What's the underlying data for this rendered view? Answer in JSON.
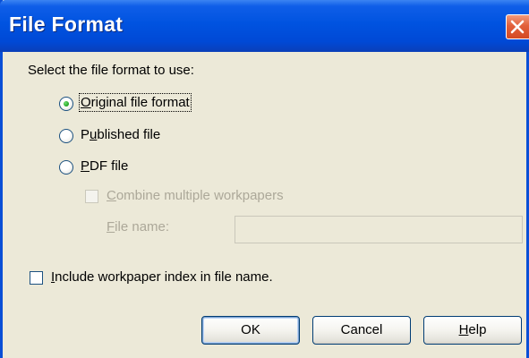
{
  "window": {
    "title": "File Format"
  },
  "prompt": "Select the file format to use:",
  "format_options": [
    {
      "label": "Original file format",
      "selected": true,
      "focused": true
    },
    {
      "label": "Published file",
      "selected": false,
      "focused": false
    },
    {
      "label": "PDF file",
      "selected": false,
      "focused": false
    }
  ],
  "pdf_options": {
    "combine_label": "Combine multiple workpapers",
    "combine_checked": false,
    "file_name_label": "File name:",
    "file_name_value": ""
  },
  "include_index": {
    "label": "Include workpaper index in file name.",
    "checked": false
  },
  "buttons": {
    "ok": "OK",
    "cancel": "Cancel",
    "help": "Help"
  },
  "colors": {
    "titlebar": "#0053e0",
    "face": "#ece9d8",
    "close": "#e2603b",
    "disabled_text": "#aca899"
  },
  "icons": {
    "close": "close-icon"
  }
}
